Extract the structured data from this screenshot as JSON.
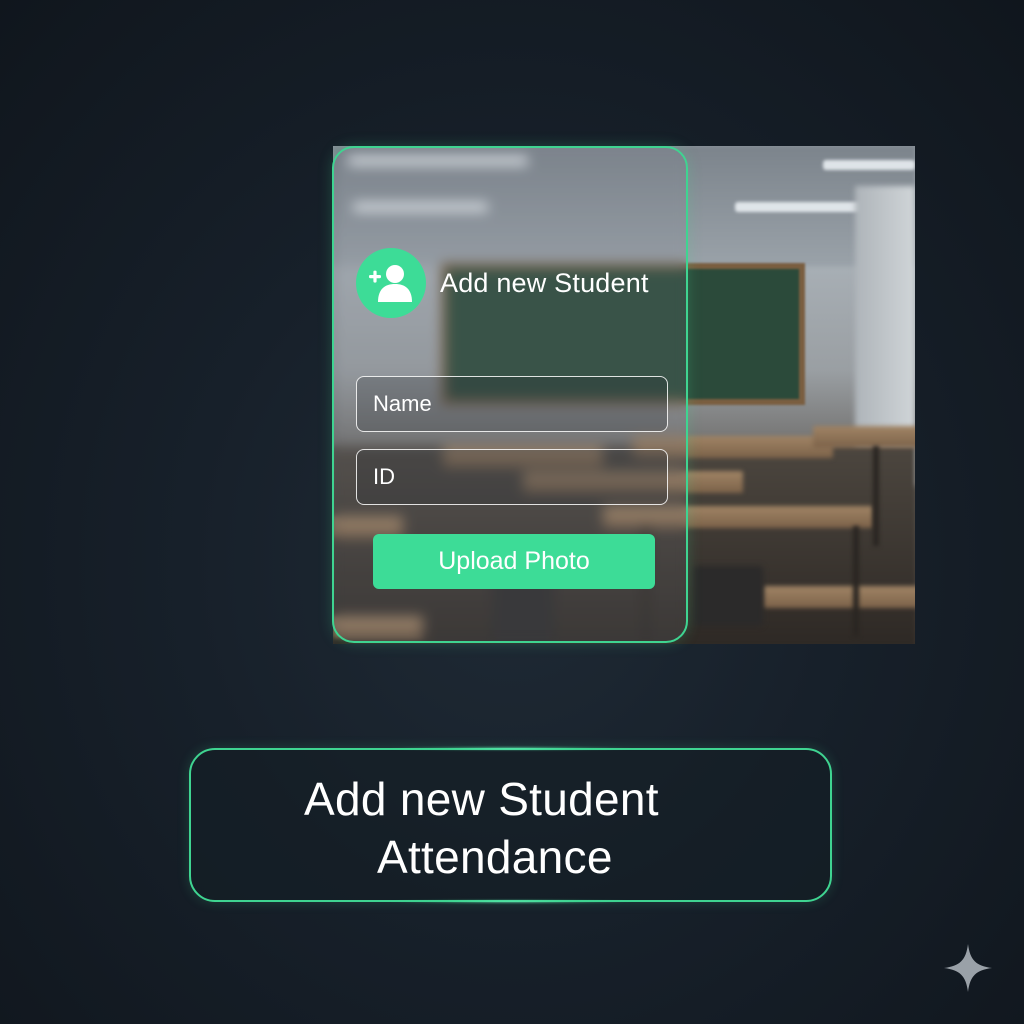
{
  "card": {
    "title": "Add new Student",
    "name_placeholder": "Name",
    "id_placeholder": "ID",
    "upload_label": "Upload Photo"
  },
  "caption": {
    "line1": "Add new Student",
    "line2": "Attendance"
  },
  "icons": {
    "avatar": "add-user-icon",
    "corner": "sparkle-icon"
  },
  "colors": {
    "accent": "#3ddc97",
    "border": "#3fd491",
    "background": "#141b24"
  }
}
